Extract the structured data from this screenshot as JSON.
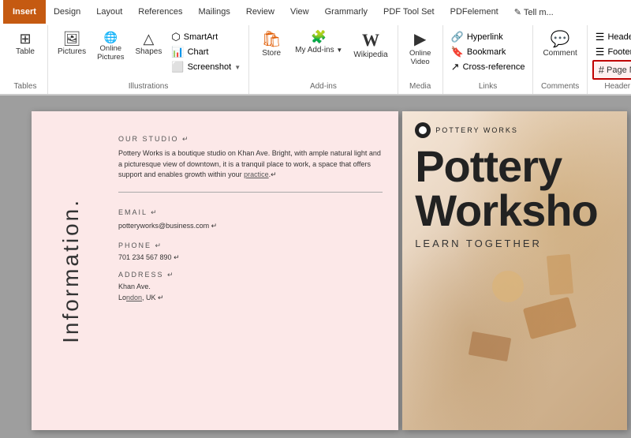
{
  "ribbon": {
    "tabs": [
      {
        "id": "insert",
        "label": "Insert",
        "active": true,
        "highlighted": true
      },
      {
        "id": "design",
        "label": "Design"
      },
      {
        "id": "layout",
        "label": "Layout"
      },
      {
        "id": "references",
        "label": "References"
      },
      {
        "id": "mailings",
        "label": "Mailings"
      },
      {
        "id": "review",
        "label": "Review"
      },
      {
        "id": "view",
        "label": "View"
      },
      {
        "id": "grammarly",
        "label": "Grammarly"
      },
      {
        "id": "pdf-toolset",
        "label": "PDF Tool Set"
      },
      {
        "id": "pdfelement",
        "label": "PDFelement"
      },
      {
        "id": "tell-me",
        "label": "✎ Tell m..."
      }
    ],
    "groups": {
      "tables": {
        "label": "Tables",
        "buttons": [
          {
            "id": "table",
            "label": "Table",
            "icon": "⊞"
          }
        ]
      },
      "illustrations": {
        "label": "Illustrations",
        "buttons": [
          {
            "id": "pictures",
            "label": "Pictures",
            "icon": "🖼"
          },
          {
            "id": "online-pictures",
            "label": "Online\nPictures",
            "icon": "🌐"
          },
          {
            "id": "shapes",
            "label": "Shapes",
            "icon": "△"
          },
          {
            "id": "smartart",
            "label": "SmartArt",
            "icon": "⬡"
          },
          {
            "id": "chart",
            "label": "Chart",
            "icon": "📊"
          },
          {
            "id": "screenshot",
            "label": "Screenshot",
            "icon": "⬜"
          }
        ]
      },
      "addins": {
        "label": "Add-ins",
        "buttons": [
          {
            "id": "store",
            "label": "Store",
            "icon": "🛍"
          },
          {
            "id": "my-addins",
            "label": "My Add-ins",
            "icon": "▼"
          },
          {
            "id": "wikipedia",
            "label": "Wikipedia",
            "icon": "W"
          }
        ]
      },
      "media": {
        "label": "Media",
        "buttons": [
          {
            "id": "online-video",
            "label": "Online\nVideo",
            "icon": "▶"
          }
        ]
      },
      "links": {
        "label": "Links",
        "buttons": [
          {
            "id": "hyperlink",
            "label": "Hyperlink",
            "icon": "🔗"
          },
          {
            "id": "bookmark",
            "label": "Bookmark",
            "icon": "🔖"
          },
          {
            "id": "cross-reference",
            "label": "Cross-reference",
            "icon": "↗"
          }
        ]
      },
      "comments": {
        "label": "Comments",
        "buttons": [
          {
            "id": "comment",
            "label": "Comment",
            "icon": "💬"
          }
        ]
      },
      "header-footer": {
        "label": "Header & Footer",
        "buttons": [
          {
            "id": "header",
            "label": "Header",
            "icon": "☰"
          },
          {
            "id": "footer",
            "label": "Footer",
            "icon": "☰"
          },
          {
            "id": "page-number",
            "label": "Page Number",
            "icon": "#",
            "highlighted": true
          }
        ]
      }
    }
  },
  "document": {
    "left_page": {
      "sidebar_text": "Information.",
      "section_our_studio": "OUR STUDIO ↵",
      "body_our_studio": "Pottery Works is a boutique studio on Khan Ave. Bright, with ample natural light and a picturesque view of downtown, it is a tranquil place to work, a space that offers support and enables growth within your practice.",
      "section_email": "EMAIL ↵",
      "email_value": "potteryworks@business.com ↵",
      "section_phone": "PHONE ↵",
      "phone_value": "701 234 567 890 ↵",
      "section_address": "ADDRESS ↵",
      "address_value": "Khan Ave.\nLondon, UK ↵"
    },
    "right_page": {
      "logo_text": "POTTERY WORKS",
      "big_title": "Pottery Worksho",
      "subtitle": "LEARN TOGETHER"
    }
  }
}
